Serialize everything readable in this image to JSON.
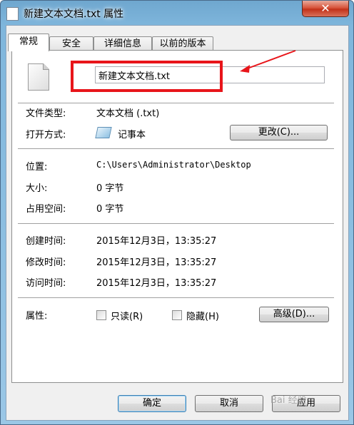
{
  "window": {
    "title": "新建文本文档.txt 属性",
    "close_glyph": "✕"
  },
  "tabs": [
    {
      "label": "常规",
      "active": true
    },
    {
      "label": "安全",
      "active": false
    },
    {
      "label": "详细信息",
      "active": false
    },
    {
      "label": "以前的版本",
      "active": false
    }
  ],
  "general": {
    "file_name": "新建文本文档.txt",
    "file_type_label": "文件类型:",
    "file_type_value": "文本文档 (.txt)",
    "open_with_label": "打开方式:",
    "open_with_value": "记事本",
    "change_button": "更改(C)...",
    "location_label": "位置:",
    "location_value": "C:\\Users\\Administrator\\Desktop",
    "size_label": "大小:",
    "size_value": "0 字节",
    "size_on_disk_label": "占用空间:",
    "size_on_disk_value": "0 字节",
    "created_label": "创建时间:",
    "created_value": "2015年12月3日，13:35:27",
    "modified_label": "修改时间:",
    "modified_value": "2015年12月3日，13:35:27",
    "accessed_label": "访问时间:",
    "accessed_value": "2015年12月3日，13:35:27",
    "attributes_label": "属性:",
    "readonly_label": "只读(R)",
    "readonly_checked": false,
    "hidden_label": "隐藏(H)",
    "hidden_checked": false,
    "advanced_button": "高级(D)..."
  },
  "footer": {
    "ok_button": "确定",
    "cancel_button": "取消",
    "apply_button": "应用"
  },
  "watermark": "Bai 经验",
  "colors": {
    "highlight_box": "#e8151a",
    "close_button": "#c2321a",
    "default_button_border": "#3c7fb1"
  }
}
